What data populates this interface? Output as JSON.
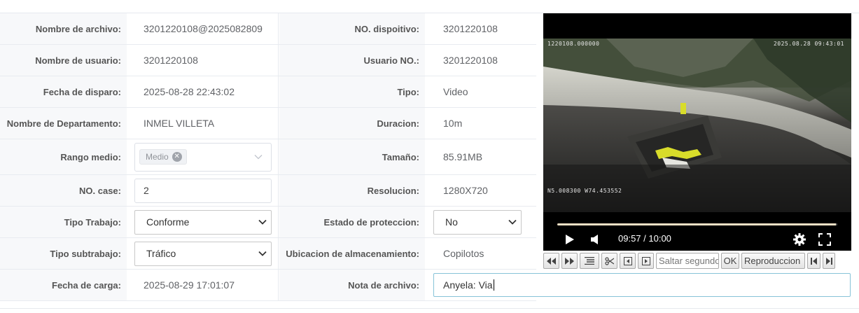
{
  "form": {
    "rows": [
      {
        "label1": "Nombre de archivo:",
        "value1": "3201220108@2025082809",
        "label2": "NO. dispoitivo:",
        "value2": "3201220108"
      },
      {
        "label1": "Nombre de usuario:",
        "value1": "3201220108",
        "label2": "Usuario NO.:",
        "value2": "3201220108"
      },
      {
        "label1": "Fecha de disparo:",
        "value1": "2025-08-28 22:43:02",
        "label2": "Tipo:",
        "value2": "Video"
      },
      {
        "label1": "Nombre de Departamento:",
        "value1": "INMEL VILLETA",
        "label2": "Duracion:",
        "value2": "10m"
      },
      {
        "label1": "Rango medio:",
        "tag": "Medio",
        "label2": "Tamaño:",
        "value2": "85.91MB"
      },
      {
        "label1": "NO. case:",
        "case_value": "2",
        "label2": "Resolucion:",
        "value2": "1280X720"
      },
      {
        "label1": "Tipo Trabajo:",
        "select1": "Conforme",
        "label2": "Estado de proteccion:",
        "select2": "No"
      },
      {
        "label1": "Tipo subtrabajo:",
        "select1": "Tráfico",
        "label2": "Ubicacion de almacenamiento:",
        "value2": "Copilotos"
      },
      {
        "label1": "Fecha de carga:",
        "value1": "2025-08-29 17:01:07",
        "label2": "Nota de archivo:",
        "note": "Anyela: Via"
      }
    ]
  },
  "video": {
    "osd_top_left": "1220108.000000",
    "osd_top_right": "2025.08.28 09:43:01",
    "osd_gps": "N5.008300  W74.453552",
    "time": "09:57 / 10:00",
    "progress": 0.995
  },
  "toolbar": {
    "seek_placeholder": "Saltar segundos",
    "ok_label": "OK",
    "playback_label": "Reproduccion"
  }
}
